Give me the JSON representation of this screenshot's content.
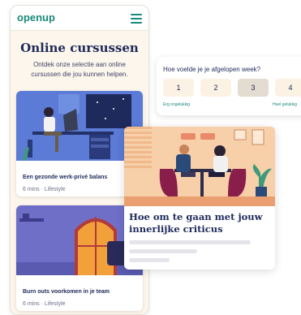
{
  "phone": {
    "logo": "openup",
    "title": "Online cursussen",
    "subtitle": "Ontdek onze selectie aan online cursussen die jou kunnen helpen.",
    "cards": [
      {
        "title": "Een gezonde werk-privé balans",
        "meta": "6 mins · Lifestyle"
      },
      {
        "title": "Burn outs voorkomen in je team",
        "meta": "6 mins · Lifestyle"
      }
    ]
  },
  "mood": {
    "question": "Hoe voelde je je afgelopen week?",
    "options": [
      "1",
      "2",
      "3",
      "4"
    ],
    "selected": "3",
    "low_label": "Erg ongelukkig",
    "high_label": "Heel gelukkig"
  },
  "article": {
    "title": "Hoe om te gaan met jouw innerlijke criticus"
  },
  "colors": {
    "brand": "#1a8a7a",
    "navy": "#1e2a5a",
    "cream": "#fdf6ec"
  },
  "icons": [
    "openup-logo-icon",
    "hamburger-menu-icon"
  ]
}
